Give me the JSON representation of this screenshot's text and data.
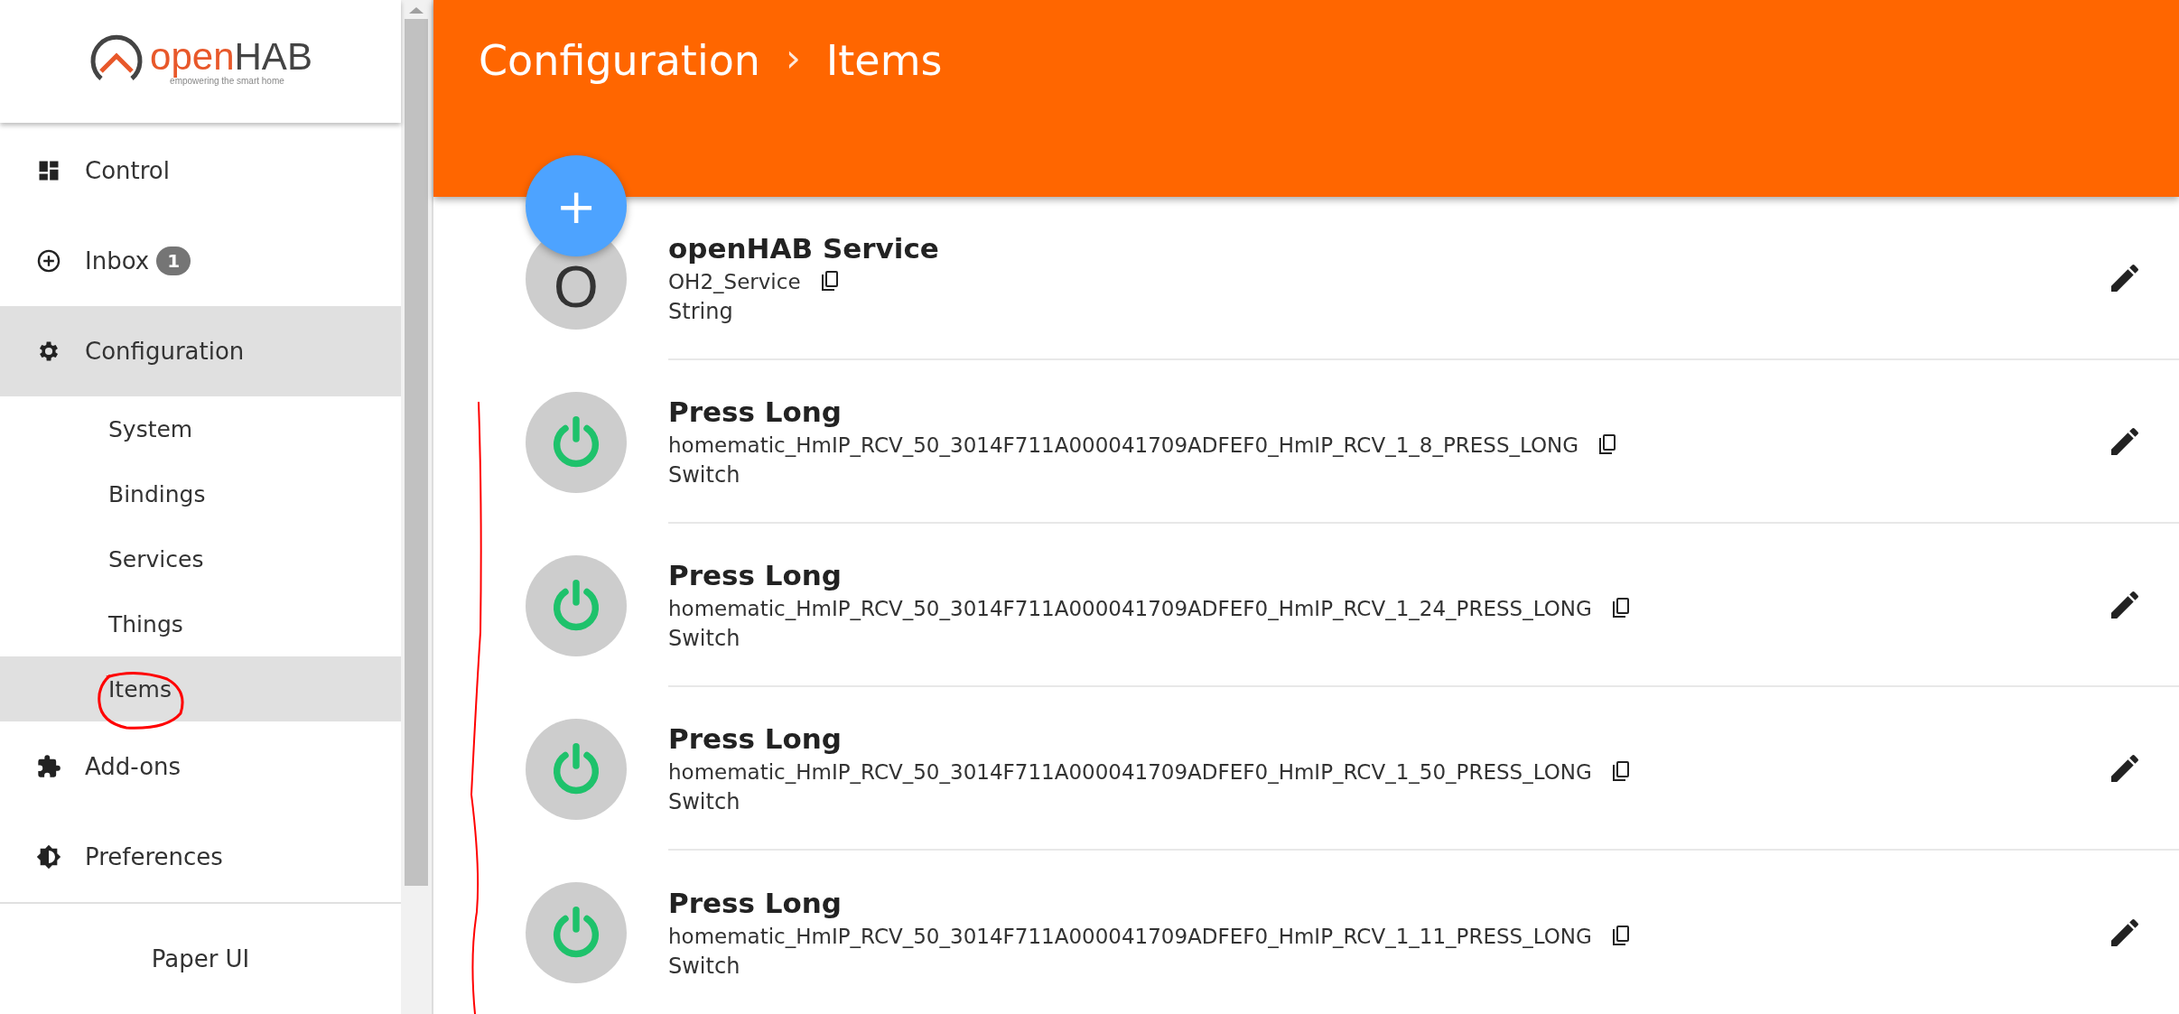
{
  "logo": {
    "name_part_1": "open",
    "name_part_2": "HAB",
    "tagline": "empowering the smart home"
  },
  "sidebar": {
    "items": [
      {
        "label": "Control",
        "kind": "dashboard",
        "selected": false
      },
      {
        "label": "Inbox",
        "kind": "inbox",
        "badge": "1",
        "selected": false
      },
      {
        "label": "Configuration",
        "kind": "settings",
        "selected": true,
        "children": [
          {
            "label": "System",
            "selected": false
          },
          {
            "label": "Bindings",
            "selected": false
          },
          {
            "label": "Services",
            "selected": false
          },
          {
            "label": "Things",
            "selected": false
          },
          {
            "label": "Items",
            "selected": true
          }
        ]
      },
      {
        "label": "Add-ons",
        "kind": "addons",
        "selected": false
      },
      {
        "label": "Preferences",
        "kind": "preferences",
        "selected": false
      }
    ],
    "footer": "Paper UI"
  },
  "header": {
    "breadcrumb": [
      "Configuration",
      "Items"
    ],
    "separator": "›"
  },
  "fab": {
    "label": "+"
  },
  "items": [
    {
      "kind": "letter",
      "avatar": "O",
      "title": "openHAB Service",
      "name": "OH2_Service",
      "type": "String"
    },
    {
      "kind": "switch",
      "title": "Press Long",
      "name": "homematic_HmIP_RCV_50_3014F711A000041709ADFEF0_HmIP_RCV_1_8_PRESS_LONG",
      "type": "Switch"
    },
    {
      "kind": "switch",
      "title": "Press Long",
      "name": "homematic_HmIP_RCV_50_3014F711A000041709ADFEF0_HmIP_RCV_1_24_PRESS_LONG",
      "type": "Switch"
    },
    {
      "kind": "switch",
      "title": "Press Long",
      "name": "homematic_HmIP_RCV_50_3014F711A000041709ADFEF0_HmIP_RCV_1_50_PRESS_LONG",
      "type": "Switch"
    },
    {
      "kind": "switch",
      "title": "Press Long",
      "name": "homematic_HmIP_RCV_50_3014F711A000041709ADFEF0_HmIP_RCV_1_11_PRESS_LONG",
      "type": "Switch"
    }
  ]
}
